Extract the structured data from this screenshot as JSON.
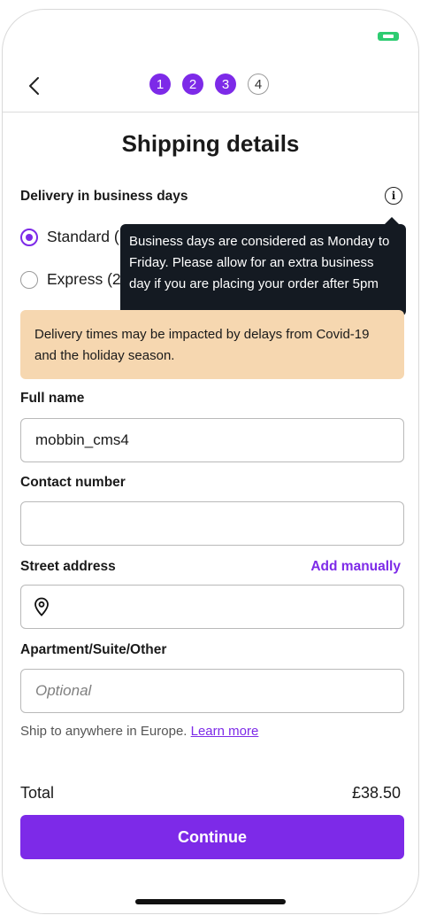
{
  "header": {
    "steps": [
      {
        "label": "1",
        "active": true
      },
      {
        "label": "2",
        "active": true
      },
      {
        "label": "3",
        "active": true
      },
      {
        "label": "4",
        "active": false
      }
    ]
  },
  "title": "Shipping details",
  "delivery": {
    "label": "Delivery in business days",
    "options": [
      {
        "label": "Standard (",
        "selected": true
      },
      {
        "label": "Express (2",
        "selected": false
      }
    ],
    "tooltip": "Business days are considered as Monday to Friday. Please allow for an extra business day if you are placing your order after 5pm"
  },
  "banner": "Delivery times may be impacted by delays from Covid-19 and the holiday season.",
  "form": {
    "full_name": {
      "label": "Full name",
      "value": "mobbin_cms4"
    },
    "contact_number": {
      "label": "Contact number",
      "value": ""
    },
    "street_address": {
      "label": "Street address",
      "action": "Add manually"
    },
    "apartment": {
      "label": "Apartment/Suite/Other",
      "placeholder": "Optional"
    }
  },
  "ship_note": {
    "text": "Ship to anywhere in Europe.",
    "link": "Learn more"
  },
  "total": {
    "label": "Total",
    "value": "£38.50"
  },
  "continue_label": "Continue",
  "colors": {
    "accent": "#7d2ae8",
    "banner": "#f6d7b0",
    "tooltip": "#141a22"
  }
}
